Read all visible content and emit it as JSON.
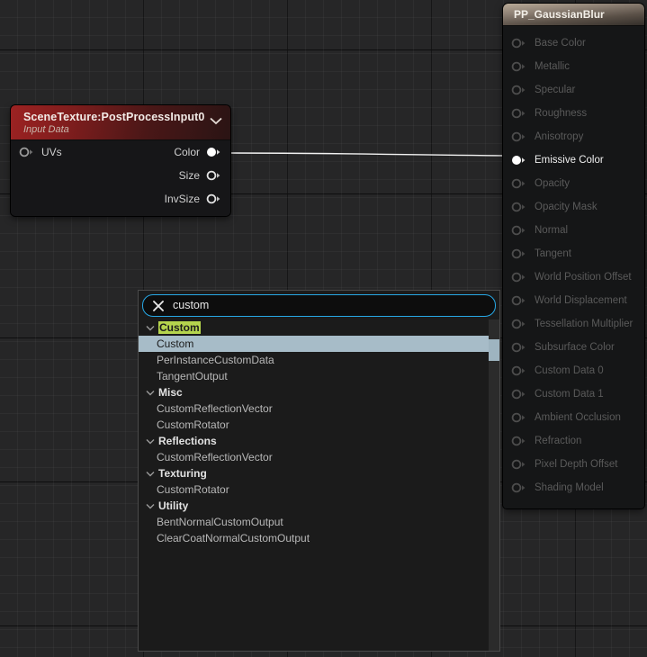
{
  "app": {
    "context": "unreal-material-editor-graph"
  },
  "colors": {
    "canvas_bg": "#262627",
    "node_red_header": "#9c2222",
    "node_tan_header": "#b9aa97",
    "search_border": "#27a8e6",
    "category_highlight": "#b5d44d",
    "selection_highlight": "#a7bcc8",
    "wire": "#f2f2f2"
  },
  "scene_texture_node": {
    "title": "SceneTexture:PostProcessInput0",
    "subtitle": "Input Data",
    "collapse_icon": "chevron-down-icon",
    "inputs": [
      {
        "label": "UVs",
        "pin": "pin-hollow-icon",
        "connected": false
      }
    ],
    "outputs": [
      {
        "label": "Color",
        "pin": "pin-filled-icon",
        "connected": true
      },
      {
        "label": "Size",
        "pin": "pin-hollow-icon",
        "connected": false
      },
      {
        "label": "InvSize",
        "pin": "pin-hollow-icon",
        "connected": false
      }
    ]
  },
  "material_node": {
    "title": "PP_GaussianBlur",
    "inputs": [
      {
        "label": "Base Color",
        "pin": "pin-hollow-icon",
        "connected": false
      },
      {
        "label": "Metallic",
        "pin": "pin-hollow-icon",
        "connected": false
      },
      {
        "label": "Specular",
        "pin": "pin-hollow-icon",
        "connected": false
      },
      {
        "label": "Roughness",
        "pin": "pin-hollow-icon",
        "connected": false
      },
      {
        "label": "Anisotropy",
        "pin": "pin-hollow-icon",
        "connected": false
      },
      {
        "label": "Emissive Color",
        "pin": "pin-filled-icon",
        "connected": true
      },
      {
        "label": "Opacity",
        "pin": "pin-hollow-icon",
        "connected": false
      },
      {
        "label": "Opacity Mask",
        "pin": "pin-hollow-icon",
        "connected": false
      },
      {
        "label": "Normal",
        "pin": "pin-hollow-icon",
        "connected": false
      },
      {
        "label": "Tangent",
        "pin": "pin-hollow-icon",
        "connected": false
      },
      {
        "label": "World Position Offset",
        "pin": "pin-hollow-icon",
        "connected": false
      },
      {
        "label": "World Displacement",
        "pin": "pin-hollow-icon",
        "connected": false
      },
      {
        "label": "Tessellation Multiplier",
        "pin": "pin-hollow-icon",
        "connected": false
      },
      {
        "label": "Subsurface Color",
        "pin": "pin-hollow-icon",
        "connected": false
      },
      {
        "label": "Custom Data 0",
        "pin": "pin-hollow-icon",
        "connected": false
      },
      {
        "label": "Custom Data 1",
        "pin": "pin-hollow-icon",
        "connected": false
      },
      {
        "label": "Ambient Occlusion",
        "pin": "pin-hollow-icon",
        "connected": false
      },
      {
        "label": "Refraction",
        "pin": "pin-hollow-icon",
        "connected": false
      },
      {
        "label": "Pixel Depth Offset",
        "pin": "pin-hollow-icon",
        "connected": false
      },
      {
        "label": "Shading Model",
        "pin": "pin-hollow-icon",
        "connected": false
      }
    ]
  },
  "palette": {
    "search": {
      "value": "custom",
      "placeholder": "Search",
      "clear_icon": "clear-x-icon"
    },
    "groups": [
      {
        "category": "Custom",
        "category_highlighted": true,
        "caret": "chevron-down-icon",
        "items": [
          {
            "label": "Custom",
            "selected": true
          },
          {
            "label": "PerInstanceCustomData",
            "selected": false
          },
          {
            "label": "TangentOutput",
            "selected": false
          }
        ]
      },
      {
        "category": "Misc",
        "category_highlighted": false,
        "caret": "chevron-down-icon",
        "items": [
          {
            "label": "CustomReflectionVector",
            "selected": false
          },
          {
            "label": "CustomRotator",
            "selected": false
          }
        ]
      },
      {
        "category": "Reflections",
        "category_highlighted": false,
        "caret": "chevron-down-icon",
        "items": [
          {
            "label": "CustomReflectionVector",
            "selected": false
          }
        ]
      },
      {
        "category": "Texturing",
        "category_highlighted": false,
        "caret": "chevron-down-icon",
        "items": [
          {
            "label": "CustomRotator",
            "selected": false
          }
        ]
      },
      {
        "category": "Utility",
        "category_highlighted": false,
        "caret": "chevron-down-icon",
        "items": [
          {
            "label": "BentNormalCustomOutput",
            "selected": false
          },
          {
            "label": "ClearCoatNormalCustomOutput",
            "selected": false
          }
        ]
      }
    ]
  }
}
